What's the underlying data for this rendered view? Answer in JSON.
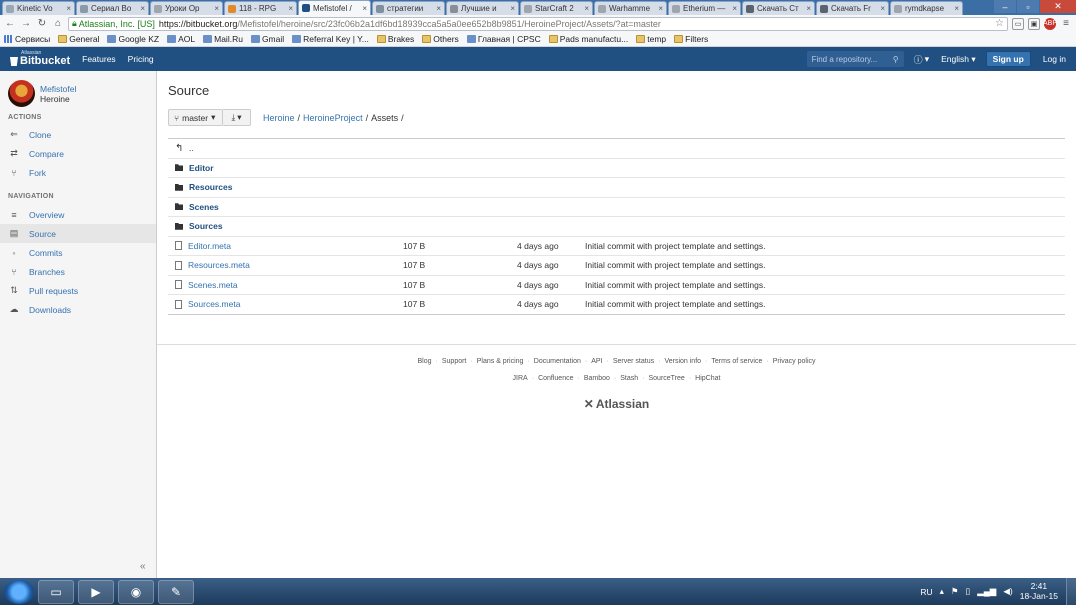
{
  "browser": {
    "tabs": [
      {
        "title": "Kinetic Vo",
        "color": "#9aa7b6",
        "active": false
      },
      {
        "title": "Сериал Во",
        "color": "#8a9aa8",
        "active": false
      },
      {
        "title": "Уроки Ор",
        "color": "#a0a6ad",
        "active": false
      },
      {
        "title": "118 - RPG",
        "color": "#e08a2c",
        "active": false
      },
      {
        "title": "Mefistofel /",
        "color": "#205081",
        "active": true
      },
      {
        "title": "стратегии",
        "color": "#7f8f9e",
        "active": false
      },
      {
        "title": "Лучшие и",
        "color": "#8b8f95",
        "active": false
      },
      {
        "title": "StarCraft 2",
        "color": "#9fa5ad",
        "active": false
      },
      {
        "title": "Warhamme",
        "color": "#9fa5ad",
        "active": false
      },
      {
        "title": "Etherium —",
        "color": "#9fa5ad",
        "active": false
      },
      {
        "title": "Скачать Ст",
        "color": "#5a6470",
        "active": false
      },
      {
        "title": "Скачать Fr",
        "color": "#5a6470",
        "active": false
      },
      {
        "title": "rymdkapse",
        "color": "#9fa5ad",
        "active": false
      }
    ],
    "secure_label": "Atlassian, Inc. [US]",
    "url_host": "https://bitbucket.org",
    "url_rest": "/Mefistofel/heroine/src/23fc06b2a1df6bd18939cca5a5a0ee652b8b9851/HeroineProject/Assets/?at=master",
    "ext_label": "ABP",
    "bookmarks": [
      {
        "label": "Сервисы",
        "kind": "apps"
      },
      {
        "label": "General",
        "kind": "folder"
      },
      {
        "label": "Google KZ",
        "kind": "site"
      },
      {
        "label": "AOL",
        "kind": "site"
      },
      {
        "label": "Mail.Ru",
        "kind": "site"
      },
      {
        "label": "Gmail",
        "kind": "site"
      },
      {
        "label": "Referral Key | Y...",
        "kind": "site"
      },
      {
        "label": "Brakes",
        "kind": "folder"
      },
      {
        "label": "Others",
        "kind": "folder"
      },
      {
        "label": "Главная | CPSC",
        "kind": "site"
      },
      {
        "label": "Pads manufactu...",
        "kind": "folder"
      },
      {
        "label": "temp",
        "kind": "folder"
      },
      {
        "label": "Filters",
        "kind": "folder"
      }
    ]
  },
  "header": {
    "logo_small": "Atlassian",
    "logo_main": "Bitbucket",
    "nav": [
      "Features",
      "Pricing"
    ],
    "search_placeholder": "Find a repository...",
    "language": "English",
    "signup": "Sign up",
    "login": "Log in"
  },
  "sidebar": {
    "owner": "Mefistofel",
    "repo": "Heroine",
    "actions_heading": "ACTIONS",
    "actions": [
      {
        "label": "Clone",
        "icon": "clone-icon",
        "glyph": "⇐"
      },
      {
        "label": "Compare",
        "icon": "compare-icon",
        "glyph": "⇄"
      },
      {
        "label": "Fork",
        "icon": "fork-icon",
        "glyph": "⑂"
      }
    ],
    "navigation_heading": "NAVIGATION",
    "navigation": [
      {
        "label": "Overview",
        "icon": "overview-icon",
        "glyph": "≡",
        "active": false
      },
      {
        "label": "Source",
        "icon": "source-icon",
        "glyph": "▤",
        "active": true
      },
      {
        "label": "Commits",
        "icon": "commits-icon",
        "glyph": "◦",
        "active": false
      },
      {
        "label": "Branches",
        "icon": "branches-icon",
        "glyph": "⑂",
        "active": false
      },
      {
        "label": "Pull requests",
        "icon": "pull-requests-icon",
        "glyph": "⇅",
        "active": false
      },
      {
        "label": "Downloads",
        "icon": "downloads-icon",
        "glyph": "☁",
        "active": false
      }
    ],
    "collapse_glyph": "«"
  },
  "main": {
    "title": "Source",
    "branch": "master",
    "breadcrumb": {
      "links": [
        "Heroine",
        "HeroineProject"
      ],
      "current": "Assets",
      "sep": "/"
    },
    "parent_label": "..",
    "folders": [
      "Editor",
      "Resources",
      "Scenes",
      "Sources"
    ],
    "files": [
      {
        "name": "Editor.meta",
        "size": "107 B",
        "date": "4 days ago",
        "message": "Initial commit with project template and settings."
      },
      {
        "name": "Resources.meta",
        "size": "107 B",
        "date": "4 days ago",
        "message": "Initial commit with project template and settings."
      },
      {
        "name": "Scenes.meta",
        "size": "107 B",
        "date": "4 days ago",
        "message": "Initial commit with project template and settings."
      },
      {
        "name": "Sources.meta",
        "size": "107 B",
        "date": "4 days ago",
        "message": "Initial commit with project template and settings."
      }
    ]
  },
  "footer": {
    "links1": [
      "Blog",
      "Support",
      "Plans & pricing",
      "Documentation",
      "API",
      "Server status",
      "Version info",
      "Terms of service",
      "Privacy policy"
    ],
    "links2": [
      "JIRA",
      "Confluence",
      "Bamboo",
      "Stash",
      "SourceTree",
      "HipChat"
    ],
    "brand": "Atlassian"
  },
  "taskbar": {
    "apps": [
      {
        "name": "explorer",
        "glyph": "▭"
      },
      {
        "name": "media-player",
        "glyph": "▶"
      },
      {
        "name": "chrome",
        "glyph": "◉"
      },
      {
        "name": "paint",
        "glyph": "✎"
      }
    ],
    "language": "RU",
    "time": "2:41",
    "date": "18-Jan-15"
  }
}
